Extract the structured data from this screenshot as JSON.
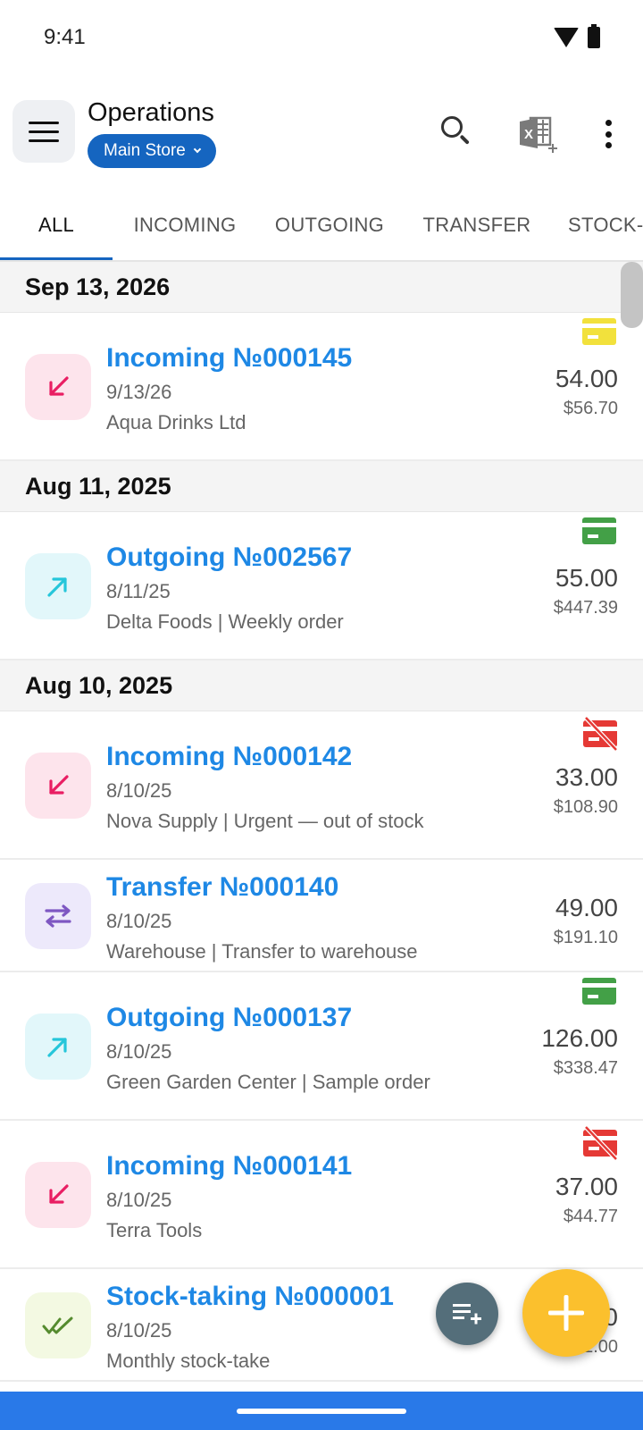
{
  "status_bar": {
    "time": "9:41"
  },
  "header": {
    "title": "Operations",
    "store": "Main Store"
  },
  "tabs": [
    {
      "label": "ALL",
      "active": true
    },
    {
      "label": "INCOMING",
      "active": false
    },
    {
      "label": "OUTGOING",
      "active": false
    },
    {
      "label": "TRANSFER",
      "active": false
    },
    {
      "label": "STOCK-",
      "active": false
    }
  ],
  "groups": [
    {
      "date": "Sep 13, 2026",
      "operations": [
        {
          "type": "incoming",
          "title": "Incoming №000145",
          "date": "9/13/26",
          "desc": "Aqua Drinks Ltd",
          "qty": "54.00",
          "sum": "$56.70",
          "payment": "card-yellow"
        }
      ]
    },
    {
      "date": "Aug 11, 2025",
      "operations": [
        {
          "type": "outgoing",
          "title": "Outgoing №002567",
          "date": "8/11/25",
          "desc": "Delta Foods  | Weekly order",
          "qty": "55.00",
          "sum": "$447.39",
          "payment": "card-green"
        }
      ]
    },
    {
      "date": "Aug 10, 2025",
      "operations": [
        {
          "type": "incoming",
          "title": "Incoming №000142",
          "date": "8/10/25",
          "desc": "Nova Supply  | Urgent — out of stock",
          "qty": "33.00",
          "sum": "$108.90",
          "payment": "card-off-red"
        },
        {
          "type": "transfer",
          "title": "Transfer №000140",
          "date": "8/10/25",
          "desc": "Warehouse | Transfer to warehouse",
          "qty": "49.00",
          "sum": "$191.10",
          "payment": "none"
        },
        {
          "type": "outgoing",
          "title": "Outgoing №000137",
          "date": "8/10/25",
          "desc": "Green Garden Center | Sample order",
          "qty": "126.00",
          "sum": "$338.47",
          "payment": "card-green"
        },
        {
          "type": "incoming",
          "title": "Incoming №000141",
          "date": "8/10/25",
          "desc": "Terra Tools",
          "qty": "37.00",
          "sum": "$44.77",
          "payment": "card-off-red"
        },
        {
          "type": "stocktaking",
          "title": "Stock-taking №000001",
          "date": "8/10/25",
          "desc": "Monthly stock-take",
          "qty": "0",
          "sum": "$812.00",
          "payment": "none"
        }
      ]
    }
  ],
  "colors": {
    "accent": "#1565c0",
    "title_blue": "#1e88e5",
    "incoming": "#e91e63",
    "outgoing": "#26c6da",
    "transfer": "#7e57c2",
    "stocktaking": "#558b2f",
    "fab": "#fbc02d"
  },
  "icons": {
    "menu": "hamburger-menu-icon",
    "search": "search-icon",
    "export": "excel-export-icon",
    "more": "more-vertical-icon",
    "add": "plus-icon",
    "filter_list": "playlist-add-icon"
  }
}
